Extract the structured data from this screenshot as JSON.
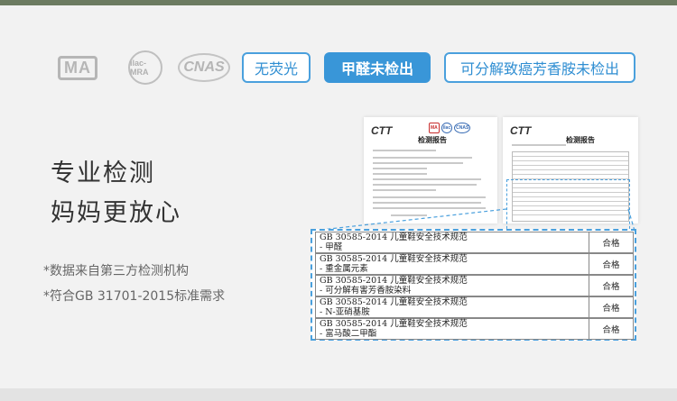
{
  "certifications": {
    "ma": "MA",
    "ilac": "ilac-MRA",
    "cnas": "CNAS"
  },
  "tags": [
    "无荧光",
    "甲醛未检出",
    "可分解致癌芳香胺未检出"
  ],
  "headline": [
    "专业检测",
    "妈妈更放心"
  ],
  "notes": [
    "*数据来自第三方检测机构",
    "*符合GB 31701-2015标准需求"
  ],
  "reports": [
    {
      "logo": "CTT",
      "title": "检测报告"
    },
    {
      "logo": "CTT",
      "title": "检测报告"
    }
  ],
  "results": [
    {
      "standard": "GB 30585-2014 儿童鞋安全技术规范",
      "item": "- 甲醛",
      "result": "合格"
    },
    {
      "standard": "GB 30585-2014 儿童鞋安全技术规范",
      "item": "- 重金属元素",
      "result": "合格"
    },
    {
      "standard": "GB 30585-2014 儿童鞋安全技术规范",
      "item": "- 可分解有害芳香胺染料",
      "result": "合格"
    },
    {
      "standard": "GB 30585-2014 儿童鞋安全技术规范",
      "item": "- N-亚硝基胺",
      "result": "合格"
    },
    {
      "standard": "GB 30585-2014 儿童鞋安全技术规范",
      "item": "- 富马酸二甲酯",
      "result": "合格"
    }
  ],
  "colors": {
    "accent": "#3996d8",
    "text": "#333333",
    "background": "#f2f2f2"
  }
}
